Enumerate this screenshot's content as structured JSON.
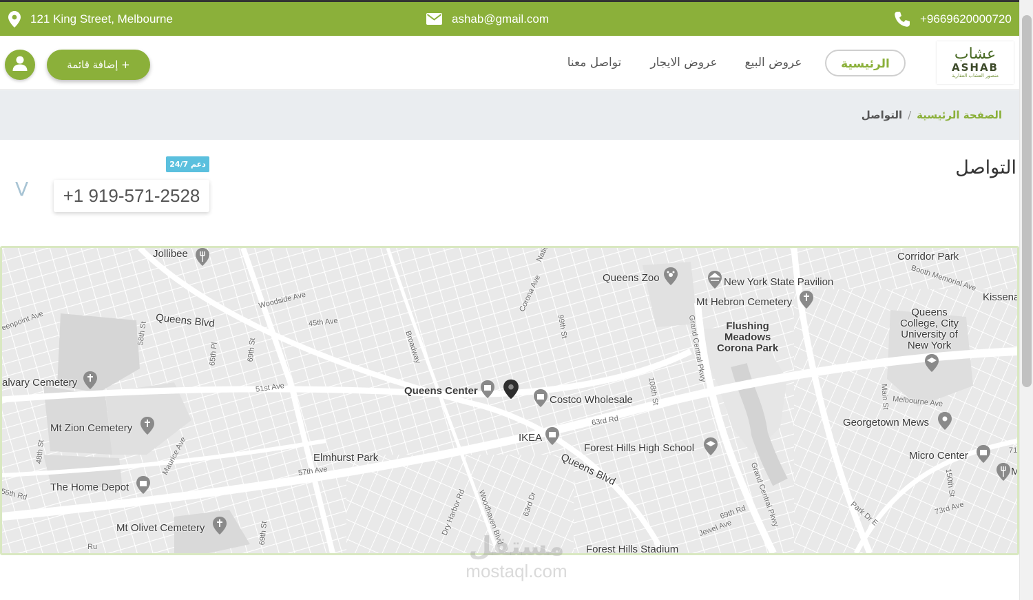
{
  "topbar": {
    "address": "121 King Street, Melbourne",
    "email": "ashab@gmail.com",
    "phone": "+9669620000720",
    "icons": [
      "location-pin-icon",
      "envelope-icon",
      "phone-icon"
    ]
  },
  "brand": {
    "logo_arabic": "عشاب",
    "logo_latin": "ASHAB",
    "logo_tagline": "منصور العشاب العقارية"
  },
  "nav": {
    "home": "الرئيسية",
    "sale": "عروض البيع",
    "rent": "عروض الايجار",
    "contact": "تواصل معنا",
    "add_listing": "إضافة قائمة +"
  },
  "breadcrumb": {
    "home": "الصفحة الرئيسية",
    "separator": "/",
    "current": "التواصل"
  },
  "contact": {
    "title": "التواصل",
    "phone": "+1 919-571-2528",
    "support_badge": "24/7 دعم",
    "chevron": "V"
  },
  "map": {
    "labels": {
      "jollibee": "Jollibee",
      "corridor_park": "Corridor Park",
      "booth_memorial": "Booth Memorial Ave",
      "kissena": "Kissena",
      "queens_zoo": "Queens Zoo",
      "ny_pavilion": "New York State Pavilion",
      "mt_hebron": "Mt Hebron Cemetery",
      "woodside_ave": "Woodside Ave",
      "queens_blvd_top": "Queens Blvd",
      "ave45": "45th Ave",
      "greenpoint": "eenpoint Ave",
      "st58": "58th St",
      "st65pl": "65th Pl",
      "st69": "69th St",
      "corona_ave": "Corona Ave",
      "st99": "99th St",
      "broadway": "Broadway",
      "national": "Natio",
      "flushing_1": "Flushing",
      "flushing_2": "Meadows",
      "flushing_3": "Corona Park",
      "gc_pkwy": "Grand Central Pkwy",
      "qc_1": "Queens",
      "qc_2": "College, City",
      "qc_3": "University of",
      "qc_4": "New York",
      "calvary": "alvary Cemetery",
      "ave51": "51st Ave",
      "queens_center": "Queens Center",
      "costco": "Costco Wholesale",
      "st108": "108th St",
      "main_st": "Main St",
      "melbourne_ave": "Melbourne Ave",
      "georgetown": "Georgetown Mews",
      "mt_zion": "Mt Zion Cemetery",
      "rd63": "63rd Rd",
      "ikea": "IKEA",
      "maurice": "Maurice Ave",
      "st48": "48th St",
      "forest_hills_hs": "Forest Hills High School",
      "elmhurst": "Elmhurst Park",
      "ave57": "57th Ave",
      "queens_blvd_low": "Queens Blvd",
      "micro_center": "Micro Center",
      "num71": "71",
      "home_depot": "The Home Depot",
      "rd56": "56th Rd",
      "gc_pkwy2": "Grand Central Pkwy",
      "st150": "150th St",
      "ave73": "73rd Ave",
      "park_dr": "Park Dr E",
      "dry_harbor": "Dry Harbor Rd",
      "woodhaven": "Woodhaven Blvd",
      "dr63": "63rd Dr",
      "rd69": "69th Rd",
      "jewel_ave": "Jewel Ave",
      "mt_olivet": "Mt Olivet Cemetery",
      "st69b": "69th St",
      "forest_hills_stadium": "Forest Hills Stadium",
      "ru": "Ru",
      "m": "M"
    }
  },
  "watermark": {
    "arabic": "مستقل",
    "latin": "mostaql.com"
  },
  "colors": {
    "accent": "#8bb03a",
    "badge": "#5bc0de",
    "breadcrumb_bg": "#eaedf0"
  }
}
